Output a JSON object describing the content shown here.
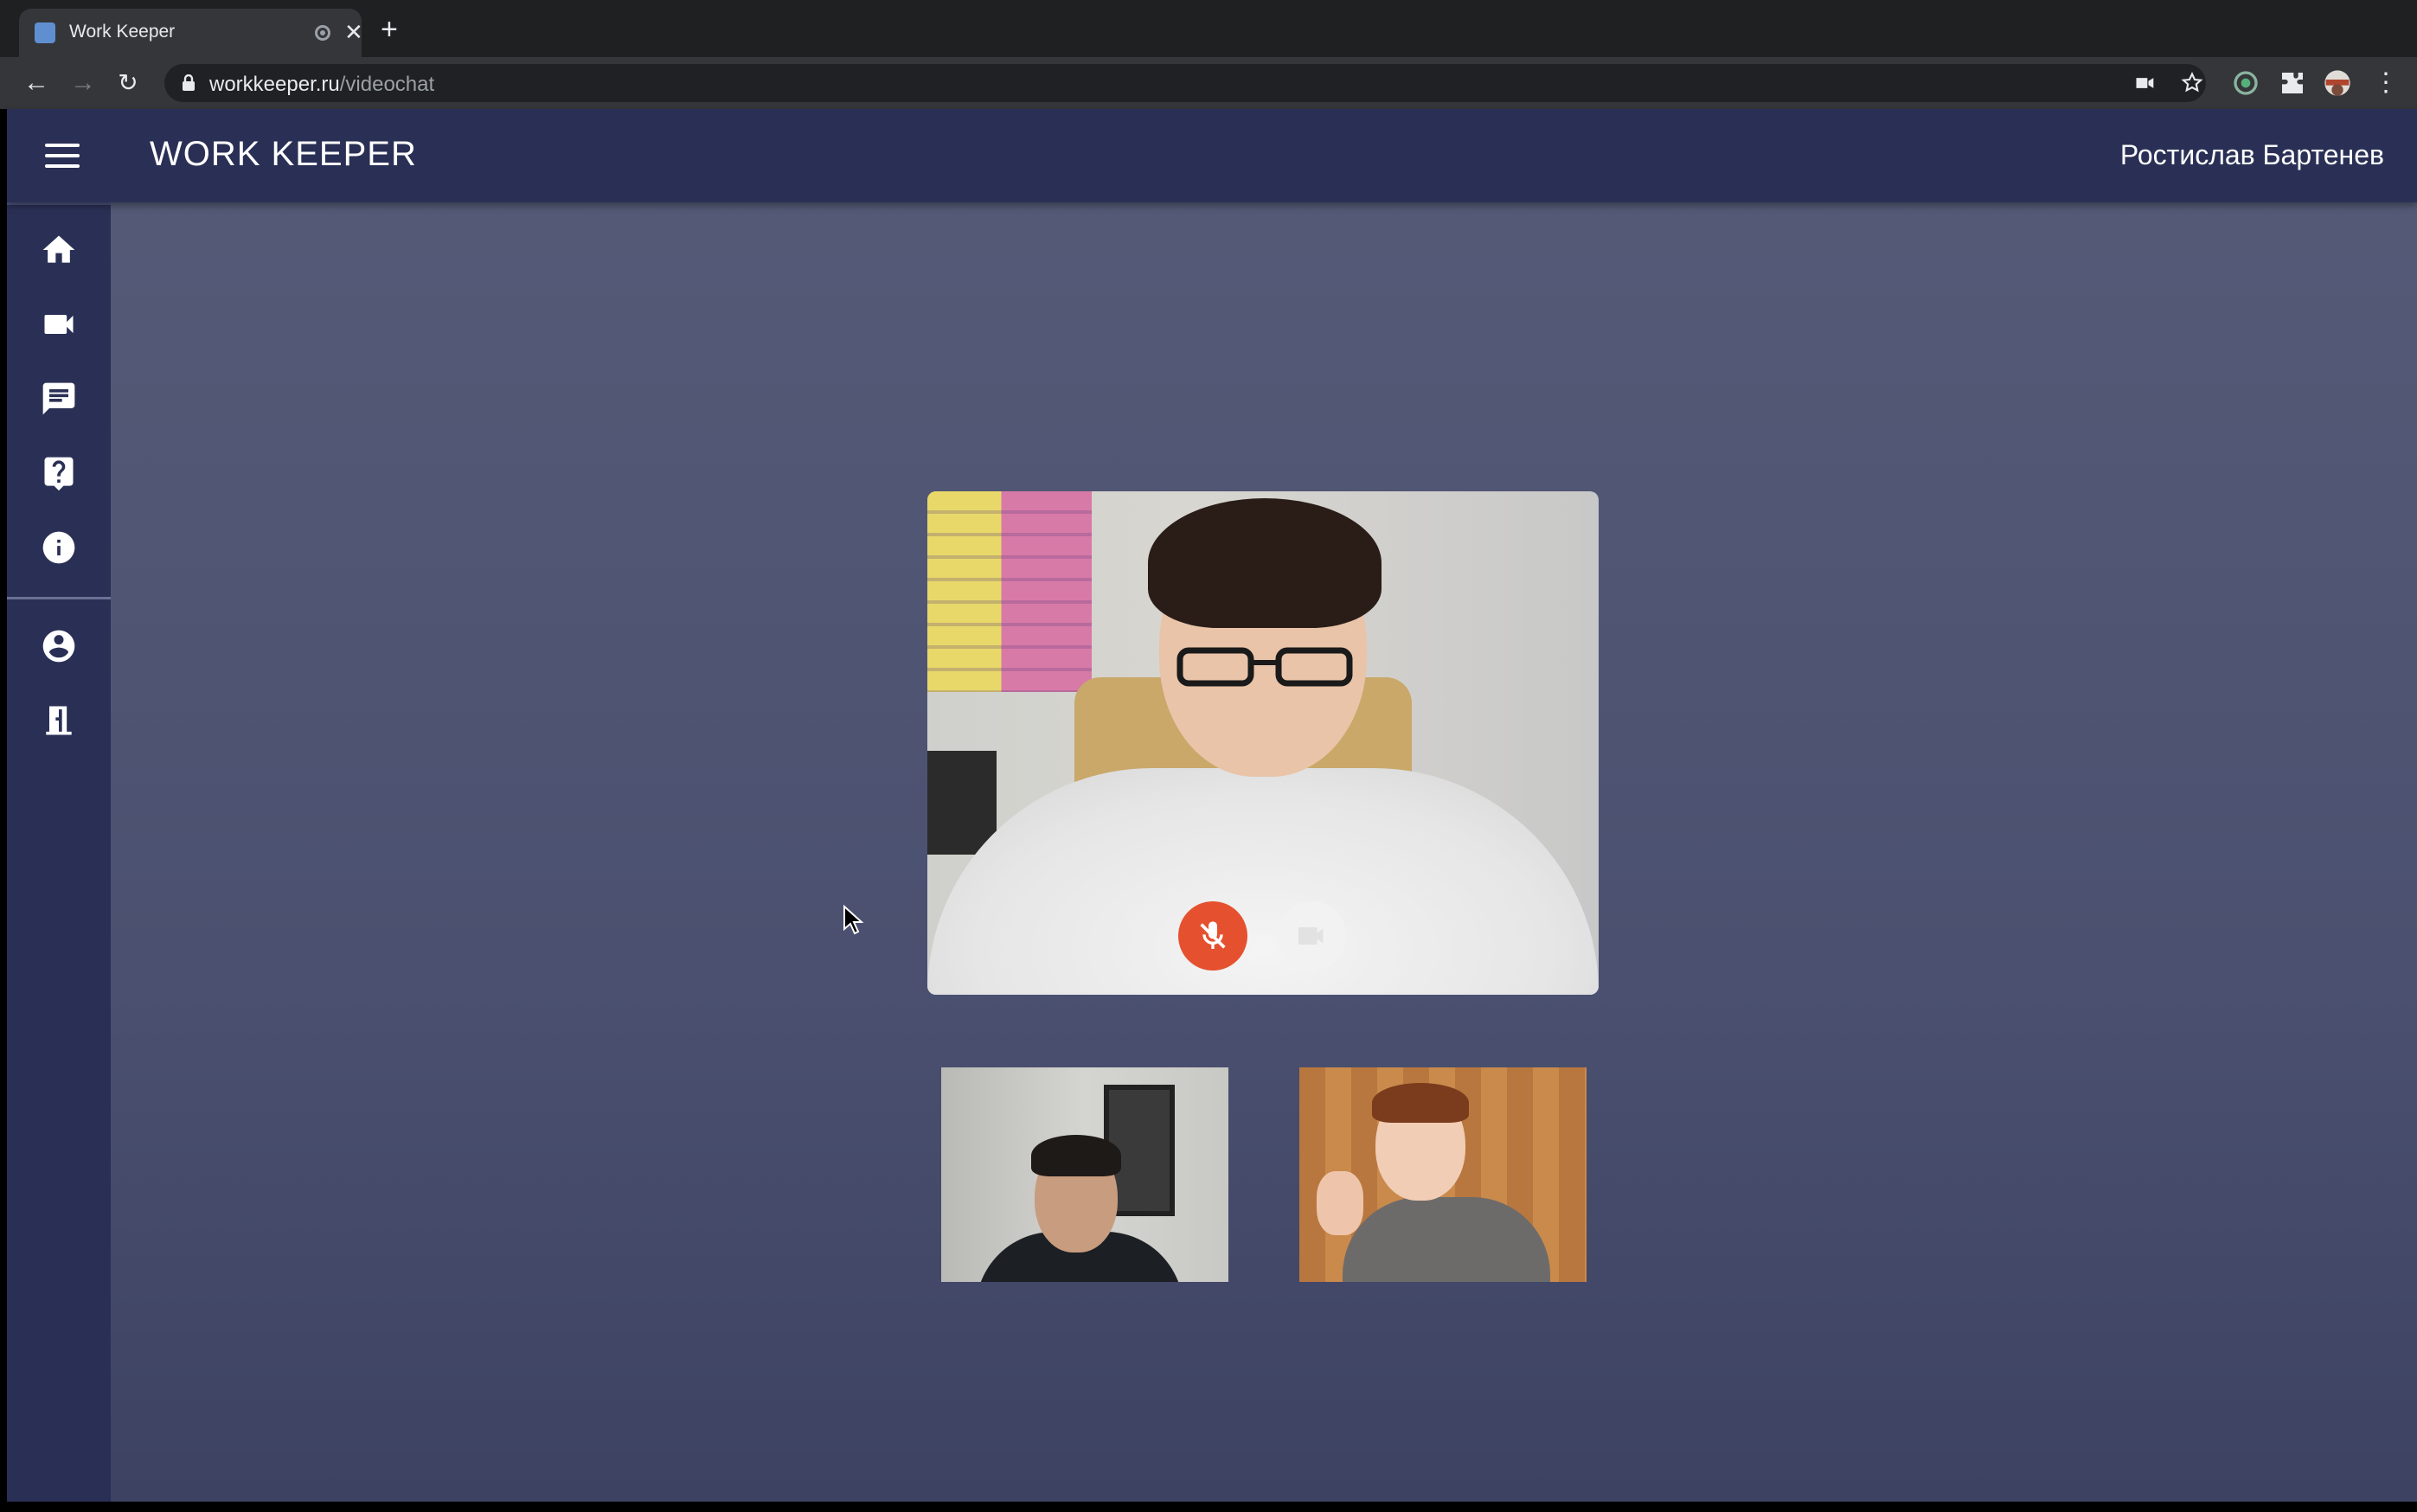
{
  "browser": {
    "tab_title": "Work Keeper",
    "url_host": "workkeeper.ru",
    "url_path": "/videochat"
  },
  "app": {
    "brand": "WORK KEEPER",
    "user_name": "Ростислав Бартенев",
    "nav_items": [
      {
        "icon": "home-icon"
      },
      {
        "icon": "videocam-icon"
      },
      {
        "icon": "chat-icon"
      },
      {
        "icon": "help-icon"
      },
      {
        "icon": "info-icon"
      },
      {
        "icon": "account-circle-icon"
      },
      {
        "icon": "exit-door-icon"
      }
    ]
  },
  "call": {
    "mic_state": "muted",
    "mute_button_color": "#e5512f",
    "camera_button_color": "#f2f2f2"
  },
  "colors": {
    "appbar": "#2a3055",
    "stage_top": "#545a76",
    "stage_bottom": "#3d4262"
  }
}
